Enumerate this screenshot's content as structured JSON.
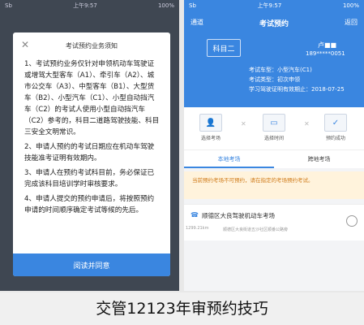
{
  "left_status": {
    "carrier": "Sb",
    "time": "上午9:57",
    "battery": "100%"
  },
  "modal": {
    "close": "✕",
    "title": "考试预约业务须知",
    "rules": [
      "1、考试预约业务仅针对申领机动车驾驶证或增驾大型客车（A1）、牵引车（A2）、城市公交车（A3）、中型客车（B1）、大型货车（B2）、小型汽车（C1）、小型自动挡汽车（C2）的考试人使用小型自动挡汽车（C2）参考的，科目二道路驾驶技能、科目三安全文明常识。",
      "2、申请人预约的考试日期应在机动车驾驶技能准考证明有效期内。",
      "3、申请人在预约考试科目前，务必保证已完成该科目培训学时审核要求。",
      "4、申请人提交的预约申请后，将按照预约申请的时间顺序确定考试等候的先后。"
    ],
    "agree_label": "阅读并同意"
  },
  "right_status": {
    "carrier": "Sb",
    "time": "上午9:57",
    "battery": "100%"
  },
  "appbar": {
    "left": "通道",
    "title": "考试预约",
    "back": "返回"
  },
  "applicant": {
    "subject": "科目二",
    "name": "卢■■",
    "id": "189*****0051",
    "lines": [
      "考试车型：小型汽车(C1)",
      "考试类型：初次申领",
      "学习驾驶证明有效期止：2018-07-25"
    ]
  },
  "steps": [
    {
      "label": "选择考场",
      "icon": "👤"
    },
    {
      "label": "选择时间",
      "icon": "▭"
    },
    {
      "label": "预约成功",
      "icon": "✓"
    }
  ],
  "tabs": [
    {
      "label": "本地考场"
    },
    {
      "label": "跨地考场"
    }
  ],
  "notice": "当前预约考场不可预约，请在指定的考场预约考试。",
  "site": {
    "phone_icon": "☎",
    "name": "顺德区大良驾驶机动车考场",
    "date": "1299.21km",
    "address": "顺德区大良街道五沙社区顺番公路旁"
  },
  "caption": "交管12123年审预约技巧"
}
